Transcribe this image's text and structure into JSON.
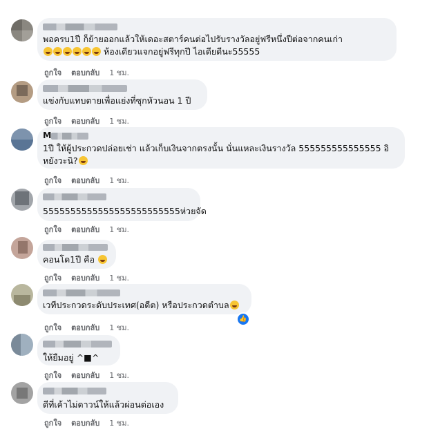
{
  "comments": [
    {
      "text_lines": [
        "พอครบ1ปี ก็ย้ายออกแล้วให้เดอะสตาร์คนต่อไปรับรางวัลอยู่ฟรีหนึ่งปีต่อจากคนเก่า",
        "ห้องเดียวแจกอยู่ฟรีทุกปี ไอเดียดีนะ55555"
      ],
      "like": "ถูกใจ",
      "reply": "ตอบกลับ",
      "time": "1 ชม."
    },
    {
      "text_lines": [
        "แข่งกับแทบตายเพื่อแย่งที่ซุกหัวนอน 1 ปี"
      ],
      "like": "ถูกใจ",
      "reply": "ตอบกลับ",
      "time": "1 ชม."
    },
    {
      "name_initial": "M",
      "text_lines": [
        "1ปี ให้ผู้ประกวดปล่อยเช่า แล้วเก็บเงินจากตรงนั้น นั่นแหละเงินรางวัล 555555555555555 อิ",
        "หยังวะนิ?"
      ],
      "like": "ถูกใจ",
      "reply": "ตอบกลับ",
      "time": "1 ชม."
    },
    {
      "text_lines": [
        "5555555555555555555555555ห่วยจัด"
      ],
      "like": "ถูกใจ",
      "reply": "ตอบกลับ",
      "time": "1 ชม."
    },
    {
      "text_lines": [
        "คอนโด1ปี คือ"
      ],
      "like": "ถูกใจ",
      "reply": "ตอบกลับ",
      "time": "1 ชม."
    },
    {
      "text_lines": [
        "เวทีประกวดระดับประเทศ(อดีต) หรือประกวดตำบล"
      ],
      "like": "ถูกใจ",
      "reply": "ตอบกลับ",
      "time": "1 ชม."
    },
    {
      "text_lines": [
        "ให้ยืมอยู่ ^■^"
      ],
      "like": "ถูกใจ",
      "reply": "ตอบกลับ",
      "time": "1 ชม."
    },
    {
      "text_lines": [
        "ดีที่เค้าไม่ดาวน์ให้แล้วผ่อนต่อเอง"
      ],
      "like": "ถูกใจ",
      "reply": "ตอบกลับ",
      "time": "1 ชม."
    }
  ],
  "colors": {
    "bubble": "#f0f2f5",
    "meta": "#65676b",
    "reaction": "#1877f2"
  }
}
